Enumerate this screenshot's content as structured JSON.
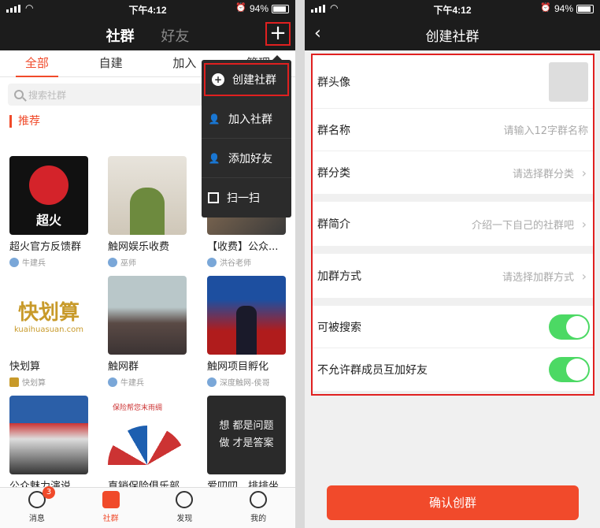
{
  "status": {
    "time": "下午4:12",
    "battery": "94%"
  },
  "left": {
    "nav_tabs": [
      "社群",
      "好友"
    ],
    "plus_label": "+",
    "tabs": [
      "全部",
      "自建",
      "加入",
      "管理"
    ],
    "search_placeholder": "搜索社群",
    "section_title": "推荐",
    "groups": [
      {
        "name": "超火官方反馈群",
        "owner": "牛建兵"
      },
      {
        "name": "触网娱乐收费",
        "owner": "巫师"
      },
      {
        "name": "【收费】公众...",
        "owner": "洪谷老师"
      },
      {
        "name": "快划算",
        "owner": "快划算"
      },
      {
        "name": "触网群",
        "owner": "牛建兵"
      },
      {
        "name": "触网项目孵化",
        "owner": "深度触网-侯哥"
      },
      {
        "name": "公众魅力演说...",
        "owner": ""
      },
      {
        "name": "直销保险俱乐部",
        "owner": ""
      },
      {
        "name": "爱叨叨，排排坐",
        "owner": ""
      }
    ],
    "image_text": {
      "g1": "超火",
      "g4a": "快划算",
      "g4b": "kuaihuasuan.com",
      "g8": "保险帮您末雨绸",
      "g9": "想 都是问题 做 才是答案"
    },
    "dropdown": [
      "创建社群",
      "加入社群",
      "添加好友",
      "扫一扫"
    ],
    "bottom": [
      {
        "label": "消息",
        "badge": "3"
      },
      {
        "label": "社群"
      },
      {
        "label": "发现"
      },
      {
        "label": "我的"
      }
    ]
  },
  "right": {
    "title": "创建社群",
    "rows": {
      "avatar": "群头像",
      "name_label": "群名称",
      "name_placeholder": "请输入12字群名称",
      "category_label": "群分类",
      "category_value": "请选择群分类",
      "intro_label": "群简介",
      "intro_value": "介绍一下自己的社群吧",
      "join_label": "加群方式",
      "join_value": "请选择加群方式",
      "searchable_label": "可被搜索",
      "no_friend_label": "不允许群成员互加好友"
    },
    "confirm": "确认创群"
  }
}
